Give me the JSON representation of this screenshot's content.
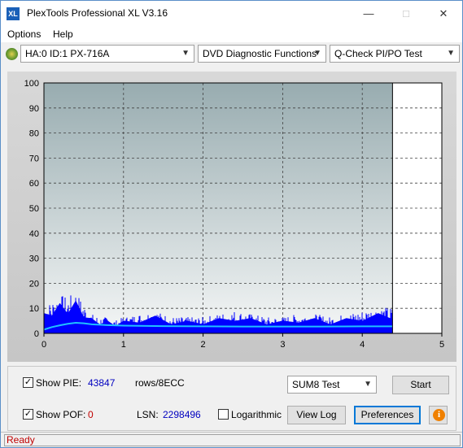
{
  "window": {
    "title": "PlexTools Professional XL V3.16",
    "icon_text": "XL"
  },
  "menu": [
    {
      "label": "Options"
    },
    {
      "label": "Help"
    }
  ],
  "toolbar": {
    "drive": "HA:0 ID:1  PX-716A",
    "function": "DVD Diagnostic Functions",
    "test": "Q-Check PI/PO Test"
  },
  "chart_data": {
    "type": "area",
    "xlim": [
      0,
      5
    ],
    "ylim": [
      0,
      100
    ],
    "x_ticks": [
      "0",
      "1",
      "2",
      "3",
      "4",
      "5"
    ],
    "y_ticks": [
      "0",
      "10",
      "20",
      "30",
      "40",
      "50",
      "60",
      "70",
      "80",
      "90",
      "100"
    ],
    "grid": true,
    "end_marker_x": 4.38,
    "series": [
      {
        "values_x": [
          0,
          0.1,
          0.2,
          0.3,
          0.4,
          0.5,
          0.6,
          0.7,
          0.8,
          0.9,
          1.0,
          1.2,
          1.4,
          1.6,
          1.8,
          2.0,
          2.2,
          2.4,
          2.6,
          2.8,
          3.0,
          3.2,
          3.4,
          3.6,
          3.8,
          4.0,
          4.2,
          4.38
        ],
        "values_y": [
          8,
          10,
          12,
          11,
          13,
          9,
          6,
          5,
          5,
          4,
          5,
          6,
          7,
          5,
          5,
          5,
          6,
          7,
          6,
          5,
          5,
          6,
          6,
          5,
          6,
          7,
          8,
          8
        ],
        "color": "#0000ff"
      },
      {
        "values_x": [
          0,
          0.1,
          0.2,
          0.3,
          0.4,
          0.5,
          0.6,
          0.8,
          1.0,
          1.5,
          2.0,
          2.5,
          3.0,
          3.5,
          4.0,
          4.38
        ],
        "values_y": [
          1.5,
          2.5,
          3.2,
          3.8,
          4.2,
          4.0,
          3.6,
          3.3,
          3.1,
          2.9,
          2.8,
          2.7,
          2.7,
          2.7,
          2.8,
          2.8
        ],
        "color": "#20c0ff"
      }
    ],
    "colors": {
      "plot_bg_top": "#98acb0",
      "plot_bg_bottom": "#f4f6f6",
      "after_marker": "#ffffff"
    }
  },
  "panel": {
    "show_pie_label": "Show PIE:",
    "pie_value": "43847",
    "pie_unit": "rows/8ECC",
    "show_pof_label": "Show POF:",
    "pof_value": "0",
    "lsn_label": "LSN:",
    "lsn_value": "2298496",
    "log_label": "Logarithmic",
    "sum_select": "SUM8 Test",
    "start": "Start",
    "view_log": "View Log",
    "preferences": "Preferences"
  },
  "status": "Ready"
}
